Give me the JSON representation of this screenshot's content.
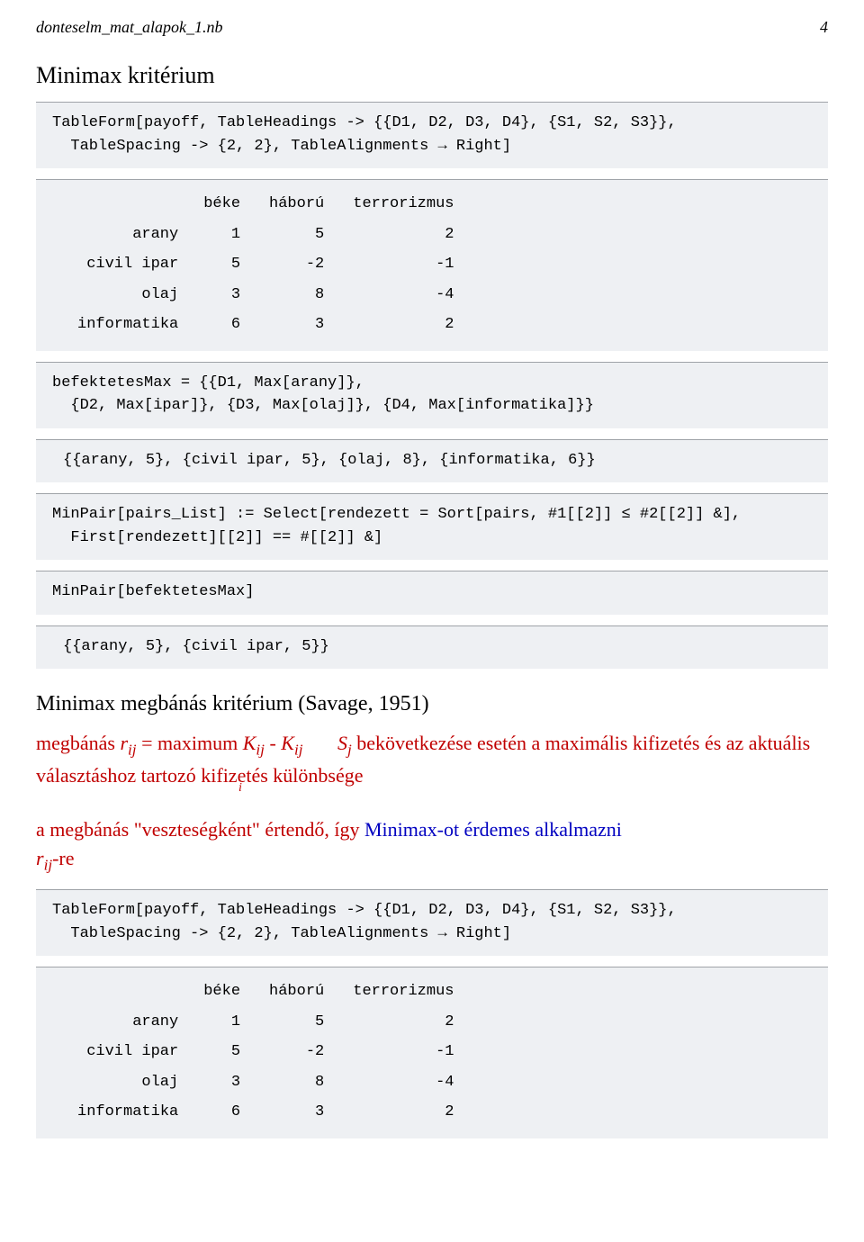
{
  "header": {
    "filename": "donteselm_mat_alapok_1.nb",
    "page": "4"
  },
  "section1": {
    "title": "Minimax kritérium",
    "code1_l1": "TableForm[payoff, TableHeadings -> {{D1, D2, D3, D4}, {S1, S2, S3}},",
    "code1_l2": "  TableSpacing -> {2, 2}, TableAlignments → Right]",
    "table": {
      "cols": [
        "béke",
        "háború",
        "terrorizmus"
      ],
      "rows": [
        {
          "label": "arany",
          "vals": [
            "1",
            "5",
            "2"
          ]
        },
        {
          "label": "civil ipar",
          "vals": [
            "5",
            "-2",
            "-1"
          ]
        },
        {
          "label": "olaj",
          "vals": [
            "3",
            "8",
            "-4"
          ]
        },
        {
          "label": "informatika",
          "vals": [
            "6",
            "3",
            "2"
          ]
        }
      ]
    },
    "code2_l1": "befektetesMax = {{D1, Max[arany]},",
    "code2_l2": "  {D2, Max[ipar]}, {D3, Max[olaj]}, {D4, Max[informatika]}}",
    "out2": "{{arany, 5}, {civil ipar, 5}, {olaj, 8}, {informatika, 6}}",
    "code3_l1": "MinPair[pairs_List] := Select[rendezett = Sort[pairs, #1[[2]] ≤ #2[[2]] &],",
    "code3_l2": "  First[rendezett][[2]] == #[[2]] &]",
    "code4": "MinPair[befektetesMax]",
    "out4": "{{arany, 5}, {civil ipar, 5}}"
  },
  "section2": {
    "title": "Minimax megbánás kritérium (Savage, 1951)",
    "p1_pre": "megbánás  ",
    "p1_rij": "r",
    "p1_eq": " = maximum ",
    "p1_K1": "K",
    "p1_minus": " - ",
    "p1_K2": "K",
    "p1_tab": "     ",
    "p1_Sj": "S",
    "p1_after": " bekövetkezése esetén a maximális kifizetés és az aktuális választáshoz tartozó kifizetés különbsége",
    "p1_sub_index": "i",
    "p2_a": "a megbánás \"veszteségként\" értendő, így ",
    "p2_b": "Minimax-ot érdemes alkalmazni",
    "p3": "-re",
    "code1_l1": "TableForm[payoff, TableHeadings -> {{D1, D2, D3, D4}, {S1, S2, S3}},",
    "code1_l2": "  TableSpacing -> {2, 2}, TableAlignments → Right]",
    "table": {
      "cols": [
        "béke",
        "háború",
        "terrorizmus"
      ],
      "rows": [
        {
          "label": "arany",
          "vals": [
            "1",
            "5",
            "2"
          ]
        },
        {
          "label": "civil ipar",
          "vals": [
            "5",
            "-2",
            "-1"
          ]
        },
        {
          "label": "olaj",
          "vals": [
            "3",
            "8",
            "-4"
          ]
        },
        {
          "label": "informatika",
          "vals": [
            "6",
            "3",
            "2"
          ]
        }
      ]
    }
  }
}
